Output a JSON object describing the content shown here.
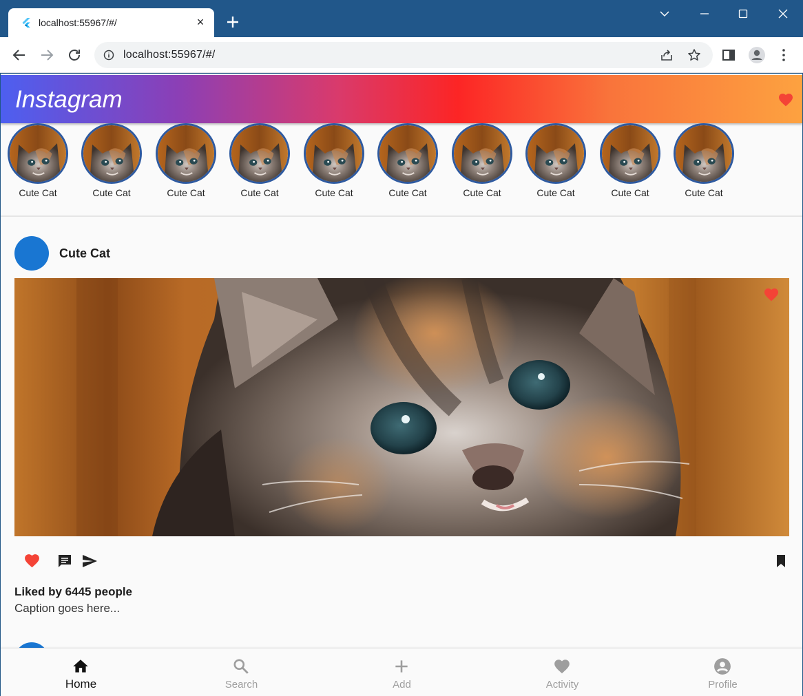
{
  "browser": {
    "tab_title": "localhost:55967/#/",
    "tab_close": "×",
    "url": "localhost:55967/#/"
  },
  "app": {
    "brand": "Instagram",
    "gradient": [
      "#4d5ff0",
      "#8b3fb6",
      "#d93a6c",
      "#fc2525",
      "#f9743b",
      "#fda240"
    ],
    "heart_color": "#f44336"
  },
  "stories": [
    {
      "label": "Cute Cat"
    },
    {
      "label": "Cute Cat"
    },
    {
      "label": "Cute Cat"
    },
    {
      "label": "Cute Cat"
    },
    {
      "label": "Cute Cat"
    },
    {
      "label": "Cute Cat"
    },
    {
      "label": "Cute Cat"
    },
    {
      "label": "Cute Cat"
    },
    {
      "label": "Cute Cat"
    },
    {
      "label": "Cute Cat"
    }
  ],
  "post": {
    "username": "Cute Cat",
    "avatar_color": "#1976d2",
    "likes_text": "Liked by 6445 people",
    "caption": "Caption goes here...",
    "icons": [
      "heart-icon",
      "comment-icon",
      "send-icon",
      "bookmark-icon"
    ]
  },
  "bottom_nav": [
    {
      "label": "Home",
      "icon": "home-icon",
      "active": true
    },
    {
      "label": "Search",
      "icon": "search-icon",
      "active": false
    },
    {
      "label": "Add",
      "icon": "add-icon",
      "active": false
    },
    {
      "label": "Activity",
      "icon": "heart-icon",
      "active": false
    },
    {
      "label": "Profile",
      "icon": "account-circle-icon",
      "active": false
    }
  ]
}
